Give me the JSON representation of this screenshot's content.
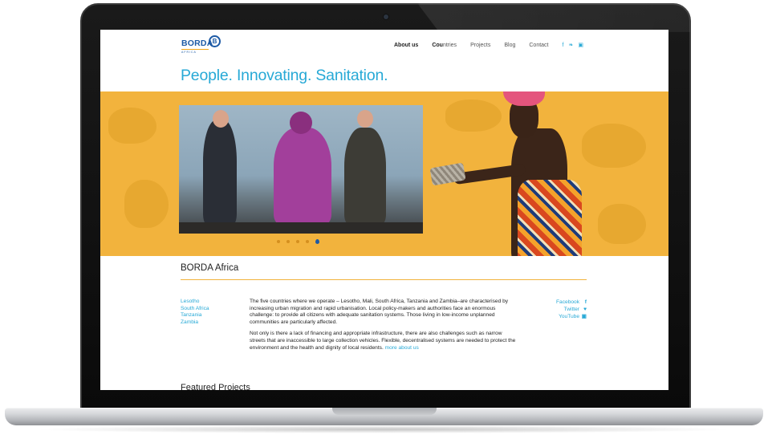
{
  "header": {
    "logo_text": "BORDA",
    "logo_mark": "B",
    "logo_sub": "AFRICA",
    "nav": [
      {
        "label": "About us"
      },
      {
        "label_bold": "Cou",
        "label_rest": "ntries"
      },
      {
        "label": "Projects"
      },
      {
        "label": "Blog"
      },
      {
        "label": "Contact"
      }
    ],
    "social_icons": [
      "facebook-icon",
      "twitter-icon",
      "youtube-icon"
    ]
  },
  "tagline": "People. Innovating. Sanitation.",
  "slider": {
    "dot_count": 5,
    "active_index": 4
  },
  "section": {
    "title": "BORDA Africa",
    "countries": [
      "Lesotho",
      "South Africa",
      "Tanzania",
      "Zambia"
    ],
    "paragraph1": "The five countries where we operate – Lesotho, Mali, South Africa, Tanzania and Zambia–are characterised by increasing urban migration and rapid urbanisation. Local policy-makers and authorities face an enormous challenge: to provide all citizens with adequate sanitation systems. Those living in low-income unplanned communities are particularly affected.",
    "paragraph2": "Not only is there a lack of financing and appropriate infrastructure, there are also challenges such as narrow streets that are inaccessible to large collection vehicles. Flexible, decentralised systems are needed to protect the environment and the health and dignity of local residents.",
    "more_link": "more about us",
    "socials": [
      {
        "label": "Facebook",
        "glyph": "f"
      },
      {
        "label": "Twitter",
        "glyph": "♥"
      },
      {
        "label": "YouTube",
        "glyph": "▣"
      }
    ]
  },
  "featured_title": "Featured Projects",
  "colors": {
    "accent": "#27a9d6",
    "brand": "#1d5aa5",
    "hero": "#f2b33d"
  }
}
